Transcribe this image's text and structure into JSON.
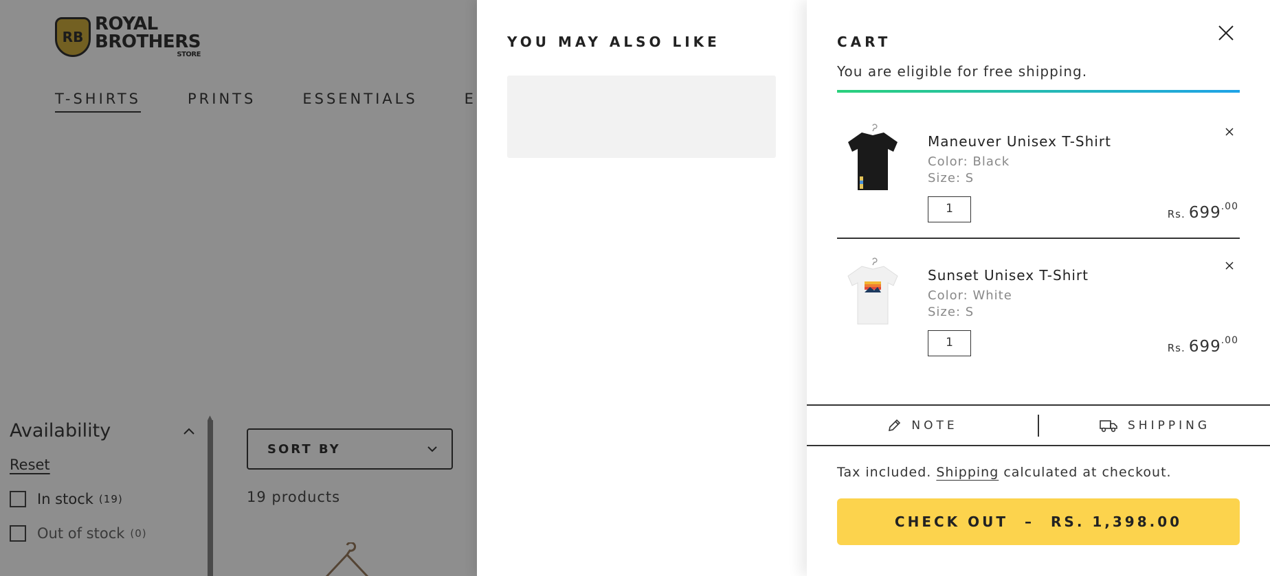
{
  "store": {
    "logo_badge": "RB",
    "logo_line1": "ROYAL",
    "logo_line2": "BROTHERS",
    "logo_sub": "STORE"
  },
  "nav": {
    "items": [
      {
        "label": "T-SHIRTS",
        "active": true
      },
      {
        "label": "PRINTS",
        "active": false
      },
      {
        "label": "ESSENTIALS",
        "active": false
      },
      {
        "label": "E",
        "active": false
      }
    ]
  },
  "filters": {
    "title": "Availability",
    "reset": "Reset",
    "options": [
      {
        "label": "In stock",
        "count": "(19)"
      },
      {
        "label": "Out of stock",
        "count": "(0)"
      }
    ]
  },
  "collection": {
    "sort_label": "SORT BY",
    "product_count": "19 products"
  },
  "upsell": {
    "title": "YOU MAY ALSO LIKE"
  },
  "cart": {
    "title": "CART",
    "shipping_message": "You are eligible for free shipping.",
    "shipping_progress": 1.0,
    "items": [
      {
        "name": "Maneuver Unisex T-Shirt",
        "color": "Color: Black",
        "size": "Size: S",
        "quantity": "1",
        "currency": "Rs.",
        "price": "699",
        "price_decimal": ".00",
        "shirt_color": "#1a1a1a"
      },
      {
        "name": "Sunset Unisex T-Shirt",
        "color": "Color: White",
        "size": "Size: S",
        "quantity": "1",
        "currency": "Rs.",
        "price": "699",
        "price_decimal": ".00",
        "shirt_color": "#f1f1f1"
      }
    ],
    "note_label": "NOTE",
    "shipping_label": "SHIPPING",
    "tax_prefix": "Tax included.",
    "tax_link": "Shipping",
    "tax_suffix": "calculated at checkout.",
    "checkout_label": "CHECK OUT",
    "checkout_separator": "–",
    "checkout_total": "RS. 1,398.00"
  },
  "colors": {
    "checkout_button": "#fcd34d",
    "progress_start": "#2ad17c",
    "progress_end": "#1fa3e8",
    "logo_gold": "#c9a227"
  }
}
